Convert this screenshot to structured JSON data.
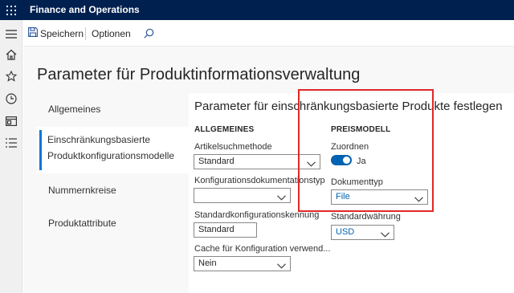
{
  "app": {
    "title": "Finance and Operations"
  },
  "toolbar": {
    "save_label": "Speichern",
    "options_label": "Optionen"
  },
  "page": {
    "title": "Parameter für Produktinformationsverwaltung"
  },
  "tabs": [
    {
      "label": "Allgemeines"
    },
    {
      "label_line1": "Einschränkungsbasierte",
      "label_line2": "Produktkonfigurationsmodelle"
    },
    {
      "label": "Nummernkreise"
    },
    {
      "label": "Produktattribute"
    }
  ],
  "panel": {
    "title": "Parameter für einschränkungsbasierte Produkte festlegen",
    "allgemeines": {
      "header": "ALLGEMEINES",
      "artikelsuche_label": "Artikelsuchmethode",
      "artikelsuche_value": "Standard",
      "konfigdoku_label": "Konfigurationsdokumentationstyp",
      "konfigdoku_value": "",
      "standardkonfig_label": "Standardkonfigurationskennung",
      "standardkonfig_value": "Standard",
      "cache_label": "Cache für Konfiguration verwend...",
      "cache_value": "Nein"
    },
    "preismodell": {
      "header": "PREISMODELL",
      "zuordnen_label": "Zuordnen",
      "zuordnen_value": "Ja",
      "dokumenttyp_label": "Dokumenttyp",
      "dokumenttyp_value": "File",
      "waehrung_label": "Standardwährung",
      "waehrung_value": "USD"
    }
  },
  "colors": {
    "topbar": "#002050",
    "accent": "#0078d4",
    "highlight": "#e02828"
  },
  "icons": [
    "waffle-icon",
    "hamburger-icon",
    "home-icon",
    "star-icon",
    "clock-icon",
    "workspace-icon",
    "list-icon",
    "save-icon",
    "search-icon",
    "chevron-down-icon"
  ]
}
